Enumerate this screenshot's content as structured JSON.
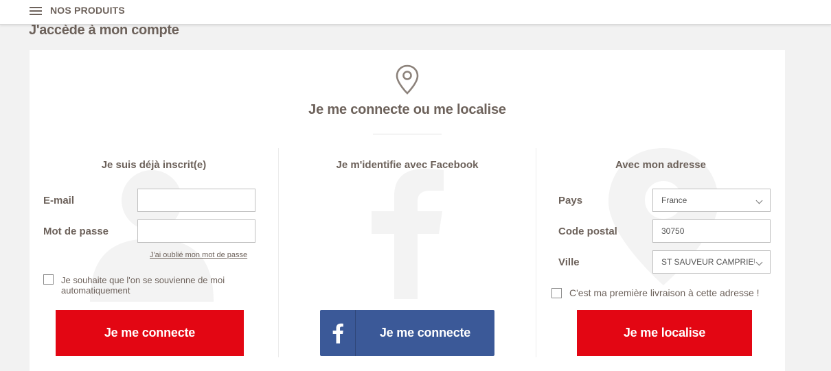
{
  "topbar": {
    "menu_label": "NOS PRODUITS"
  },
  "page": {
    "title": "J'accède à mon compte"
  },
  "card": {
    "title": "Je me connecte ou me localise"
  },
  "login": {
    "title": "Je suis déjà inscrit(e)",
    "email_label": "E-mail",
    "email_value": "",
    "password_label": "Mot de passe",
    "password_value": "",
    "forgot_link": "J'ai oublié mon mot de passe",
    "remember_line1": "Je souhaite que l'on se souvienne de moi",
    "remember_line2": "automatiquement",
    "button": "Je me connecte"
  },
  "facebook": {
    "title": "Je m'identifie avec Facebook",
    "button": "Je me connecte"
  },
  "address": {
    "title": "Avec mon adresse",
    "country_label": "Pays",
    "country_value": "France",
    "postal_label": "Code postal",
    "postal_value": "30750",
    "city_label": "Ville",
    "city_value": "ST SAUVEUR CAMPRIEU",
    "first_delivery": "C'est ma première livraison à cette adresse !",
    "button": "Je me localise"
  },
  "colors": {
    "brand_red": "#e30613",
    "facebook_blue": "#3b5998",
    "text_brown": "#6d625b"
  },
  "icons": [
    "hamburger-icon",
    "location-pin-icon",
    "user-background-icon",
    "facebook-background-icon",
    "pin-background-icon",
    "facebook-icon",
    "chevron-down-icon"
  ]
}
